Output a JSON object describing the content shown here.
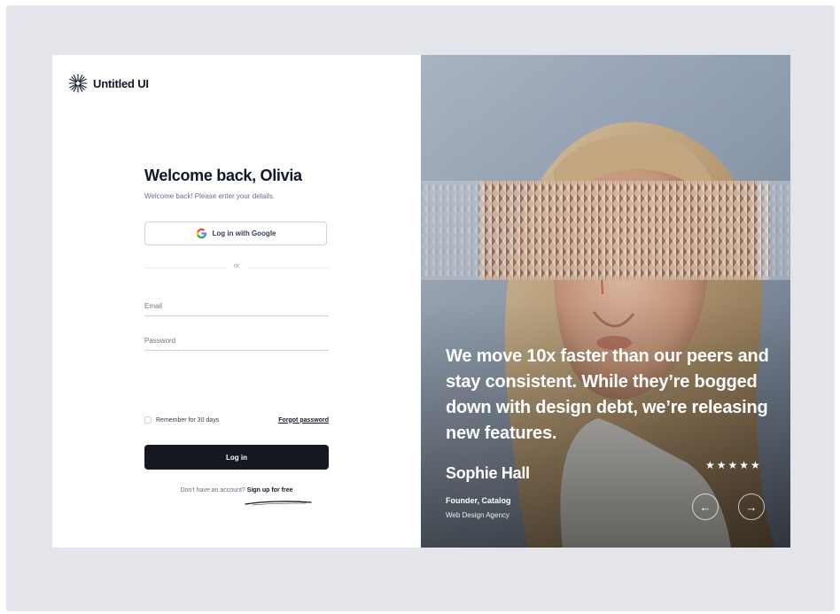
{
  "brand": {
    "name": "Untitled UI"
  },
  "login": {
    "title": "Welcome back, Olivia",
    "subtitle": "Welcome back! Please enter your details.",
    "google_label": "Log in with Google",
    "divider_text": "or",
    "email_placeholder": "Email",
    "password_placeholder": "Password",
    "remember_label": "Remember for 30 days",
    "forgot_label": "Forgot password",
    "login_label": "Log in",
    "signup_prompt": "Don't have an account?",
    "signup_link": "Sign up for free"
  },
  "testimonial": {
    "quote": "We move 10x faster than our peers and stay consistent. While they’re bogged down with design debt, we’re releasing new features.",
    "author": "Sophie Hall",
    "role": "Founder, Catalog",
    "company": "Web Design Agency",
    "rating": "★★★★★",
    "prev_icon": "←",
    "next_icon": "→"
  },
  "colors": {
    "page_bg": "#e3e5ea",
    "primary_button": "#151821",
    "text_primary": "#101828",
    "text_secondary": "#667085"
  }
}
